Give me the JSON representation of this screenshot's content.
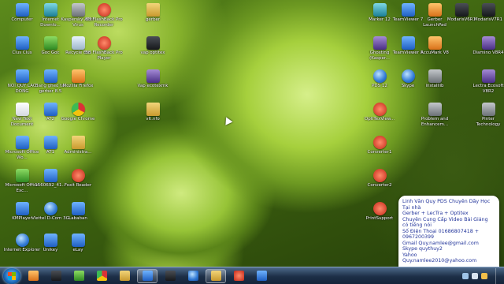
{
  "desktop_icons": [
    {
      "label": "Computer",
      "icon": "computer-icon",
      "style": "blue"
    },
    {
      "label": "Internet Downlo...",
      "icon": "idm-icon",
      "style": "teal"
    },
    {
      "label": "Kaspersky ANti-Virus",
      "icon": "kaspersky-icon",
      "style": "gray"
    },
    {
      "label": "BB FlashBack Pro Recorder",
      "icon": "flashback-recorder-icon",
      "style": "red"
    },
    {
      "label": "gerber",
      "icon": "folder-icon",
      "style": "folder"
    },
    {
      "label": "Marker 12",
      "icon": "marker-icon",
      "style": "teal"
    },
    {
      "label": "TeamViewer 7",
      "icon": "teamviewer-icon",
      "style": "blue"
    },
    {
      "label": "Gerber LaunchPad",
      "icon": "gerber-launchpad-icon",
      "style": "orange"
    },
    {
      "label": "ModarisV6R1",
      "icon": "modaris-icon",
      "style": "dark"
    },
    {
      "label": "ModarisV7R1",
      "icon": "modaris-icon",
      "style": "dark"
    },
    {
      "label": "Clus Clus",
      "icon": "network-icon",
      "style": "blue"
    },
    {
      "label": "Goc Goc",
      "icon": "network-icon",
      "style": "green"
    },
    {
      "label": "Recycle Bin",
      "icon": "recycle-bin-icon",
      "style": "recycle"
    },
    {
      "label": "BB FlashBack Pro Player",
      "icon": "flashback-player-icon",
      "style": "red"
    },
    {
      "label": "vap optitex",
      "icon": "document-icon",
      "style": "dark"
    },
    {
      "label": "Ghosting (Kasper...",
      "icon": "app-icon",
      "style": "purple"
    },
    {
      "label": "TeamViewer 8",
      "icon": "teamviewer-icon",
      "style": "blue"
    },
    {
      "label": "AccuMark V8",
      "icon": "accumark-icon",
      "style": "orange"
    },
    {
      "label": "Diamino V8R4",
      "icon": "diamino-icon",
      "style": "purple"
    },
    {
      "label": "NOI QUY LAO DONG",
      "icon": "word-doc-icon",
      "style": "blue"
    },
    {
      "label": "Bang gheo tai gerber 8.5",
      "icon": "word-doc-icon",
      "style": "blue"
    },
    {
      "label": "Mozilla Firefox",
      "icon": "firefox-icon",
      "style": "orange"
    },
    {
      "label": "Vap ecotexmk",
      "icon": "app-icon",
      "style": "purple"
    },
    {
      "label": "PDS 12",
      "icon": "pds-icon",
      "style": "globe"
    },
    {
      "label": "Skype",
      "icon": "skype-icon",
      "style": "globe"
    },
    {
      "label": "installlib",
      "icon": "installer-icon",
      "style": "gray"
    },
    {
      "label": "Lectra Ecosoft V8R2",
      "icon": "lectra-icon",
      "style": "purple"
    },
    {
      "label": "New Text Document",
      "icon": "text-document-icon",
      "style": "doc"
    },
    {
      "label": "AT2",
      "icon": "folder-icon",
      "style": "blue"
    },
    {
      "label": "Google Chrome",
      "icon": "chrome-icon",
      "style": "chrome"
    },
    {
      "label": "vlt.nfo",
      "icon": "folder-icon",
      "style": "folder"
    },
    {
      "label": "OptiTexView...",
      "icon": "optitex-icon",
      "style": "red"
    },
    {
      "label": "Problem and Enhancem...",
      "icon": "app-icon",
      "style": "gray"
    },
    {
      "label": "Pinter Technology",
      "icon": "app-icon",
      "style": "gray"
    },
    {
      "label": "Microsoft Office Wo...",
      "icon": "word-icon",
      "style": "blue"
    },
    {
      "label": "AT1",
      "icon": "folder-icon",
      "style": "blue"
    },
    {
      "label": "Administra...",
      "icon": "admin-icon",
      "style": "folder"
    },
    {
      "label": "Converter1",
      "icon": "converter-icon",
      "style": "red"
    },
    {
      "label": "Microsoft Office Exc...",
      "icon": "excel-icon",
      "style": "green"
    },
    {
      "label": "1560692_41...",
      "icon": "image-icon",
      "style": "blue"
    },
    {
      "label": "Foxit Reader",
      "icon": "foxit-icon",
      "style": "red"
    },
    {
      "label": "Converter2",
      "icon": "converter-icon",
      "style": "red"
    },
    {
      "label": "KMPlayer",
      "icon": "kmplayer-icon",
      "style": "blue"
    },
    {
      "label": "Viettel D-Com 3G",
      "icon": "dcom-icon",
      "style": "globe"
    },
    {
      "label": "Lababan",
      "icon": "app-icon",
      "style": "blue"
    },
    {
      "label": "PrintSupport",
      "icon": "print-icon",
      "style": "red"
    },
    {
      "label": "Internet Explorer",
      "icon": "ie-icon",
      "style": "globe"
    },
    {
      "label": "Unikey",
      "icon": "unikey-icon",
      "style": "blue"
    },
    {
      "label": "eLay",
      "icon": "app-icon",
      "style": "blue"
    }
  ],
  "info_note": {
    "lines": [
      "Linh Văn Quy PDS Chuyên Dãy Học",
      "Tại nhà",
      "Gerber + LecTra + Optitex",
      "Chuyên Cung Cấp Video Bài Giảng",
      "có tiếng nói",
      "Số Điện Thoại 01686807418 +",
      "0967200399",
      "Gmail Quy.namlee@gmail.com",
      "Skype quythuy2",
      "Yahoo",
      "Quy.namlee2010@yahoo.com"
    ]
  },
  "taskbar": {
    "pinned": [
      {
        "icon": "media-player-icon",
        "style": "orange",
        "active": false
      },
      {
        "icon": "video-icon",
        "style": "dark",
        "active": false
      },
      {
        "icon": "green-app-icon",
        "style": "green",
        "active": false
      },
      {
        "icon": "chrome-icon",
        "style": "chrome",
        "active": false
      },
      {
        "icon": "explorer-folder-icon",
        "style": "folder",
        "active": false
      },
      {
        "icon": "window-icon",
        "style": "blue",
        "active": true
      },
      {
        "icon": "monitor-icon",
        "style": "dark",
        "active": false
      },
      {
        "icon": "skype-icon",
        "style": "globe",
        "active": false
      },
      {
        "icon": "folder-icon",
        "style": "folder",
        "active": true
      },
      {
        "icon": "red-app-icon",
        "style": "red",
        "active": false
      },
      {
        "icon": "image-viewer-icon",
        "style": "blue",
        "active": false
      }
    ],
    "tray_icons": [
      "network-tray-icon",
      "volume-tray-icon",
      "action-center-icon"
    ]
  }
}
